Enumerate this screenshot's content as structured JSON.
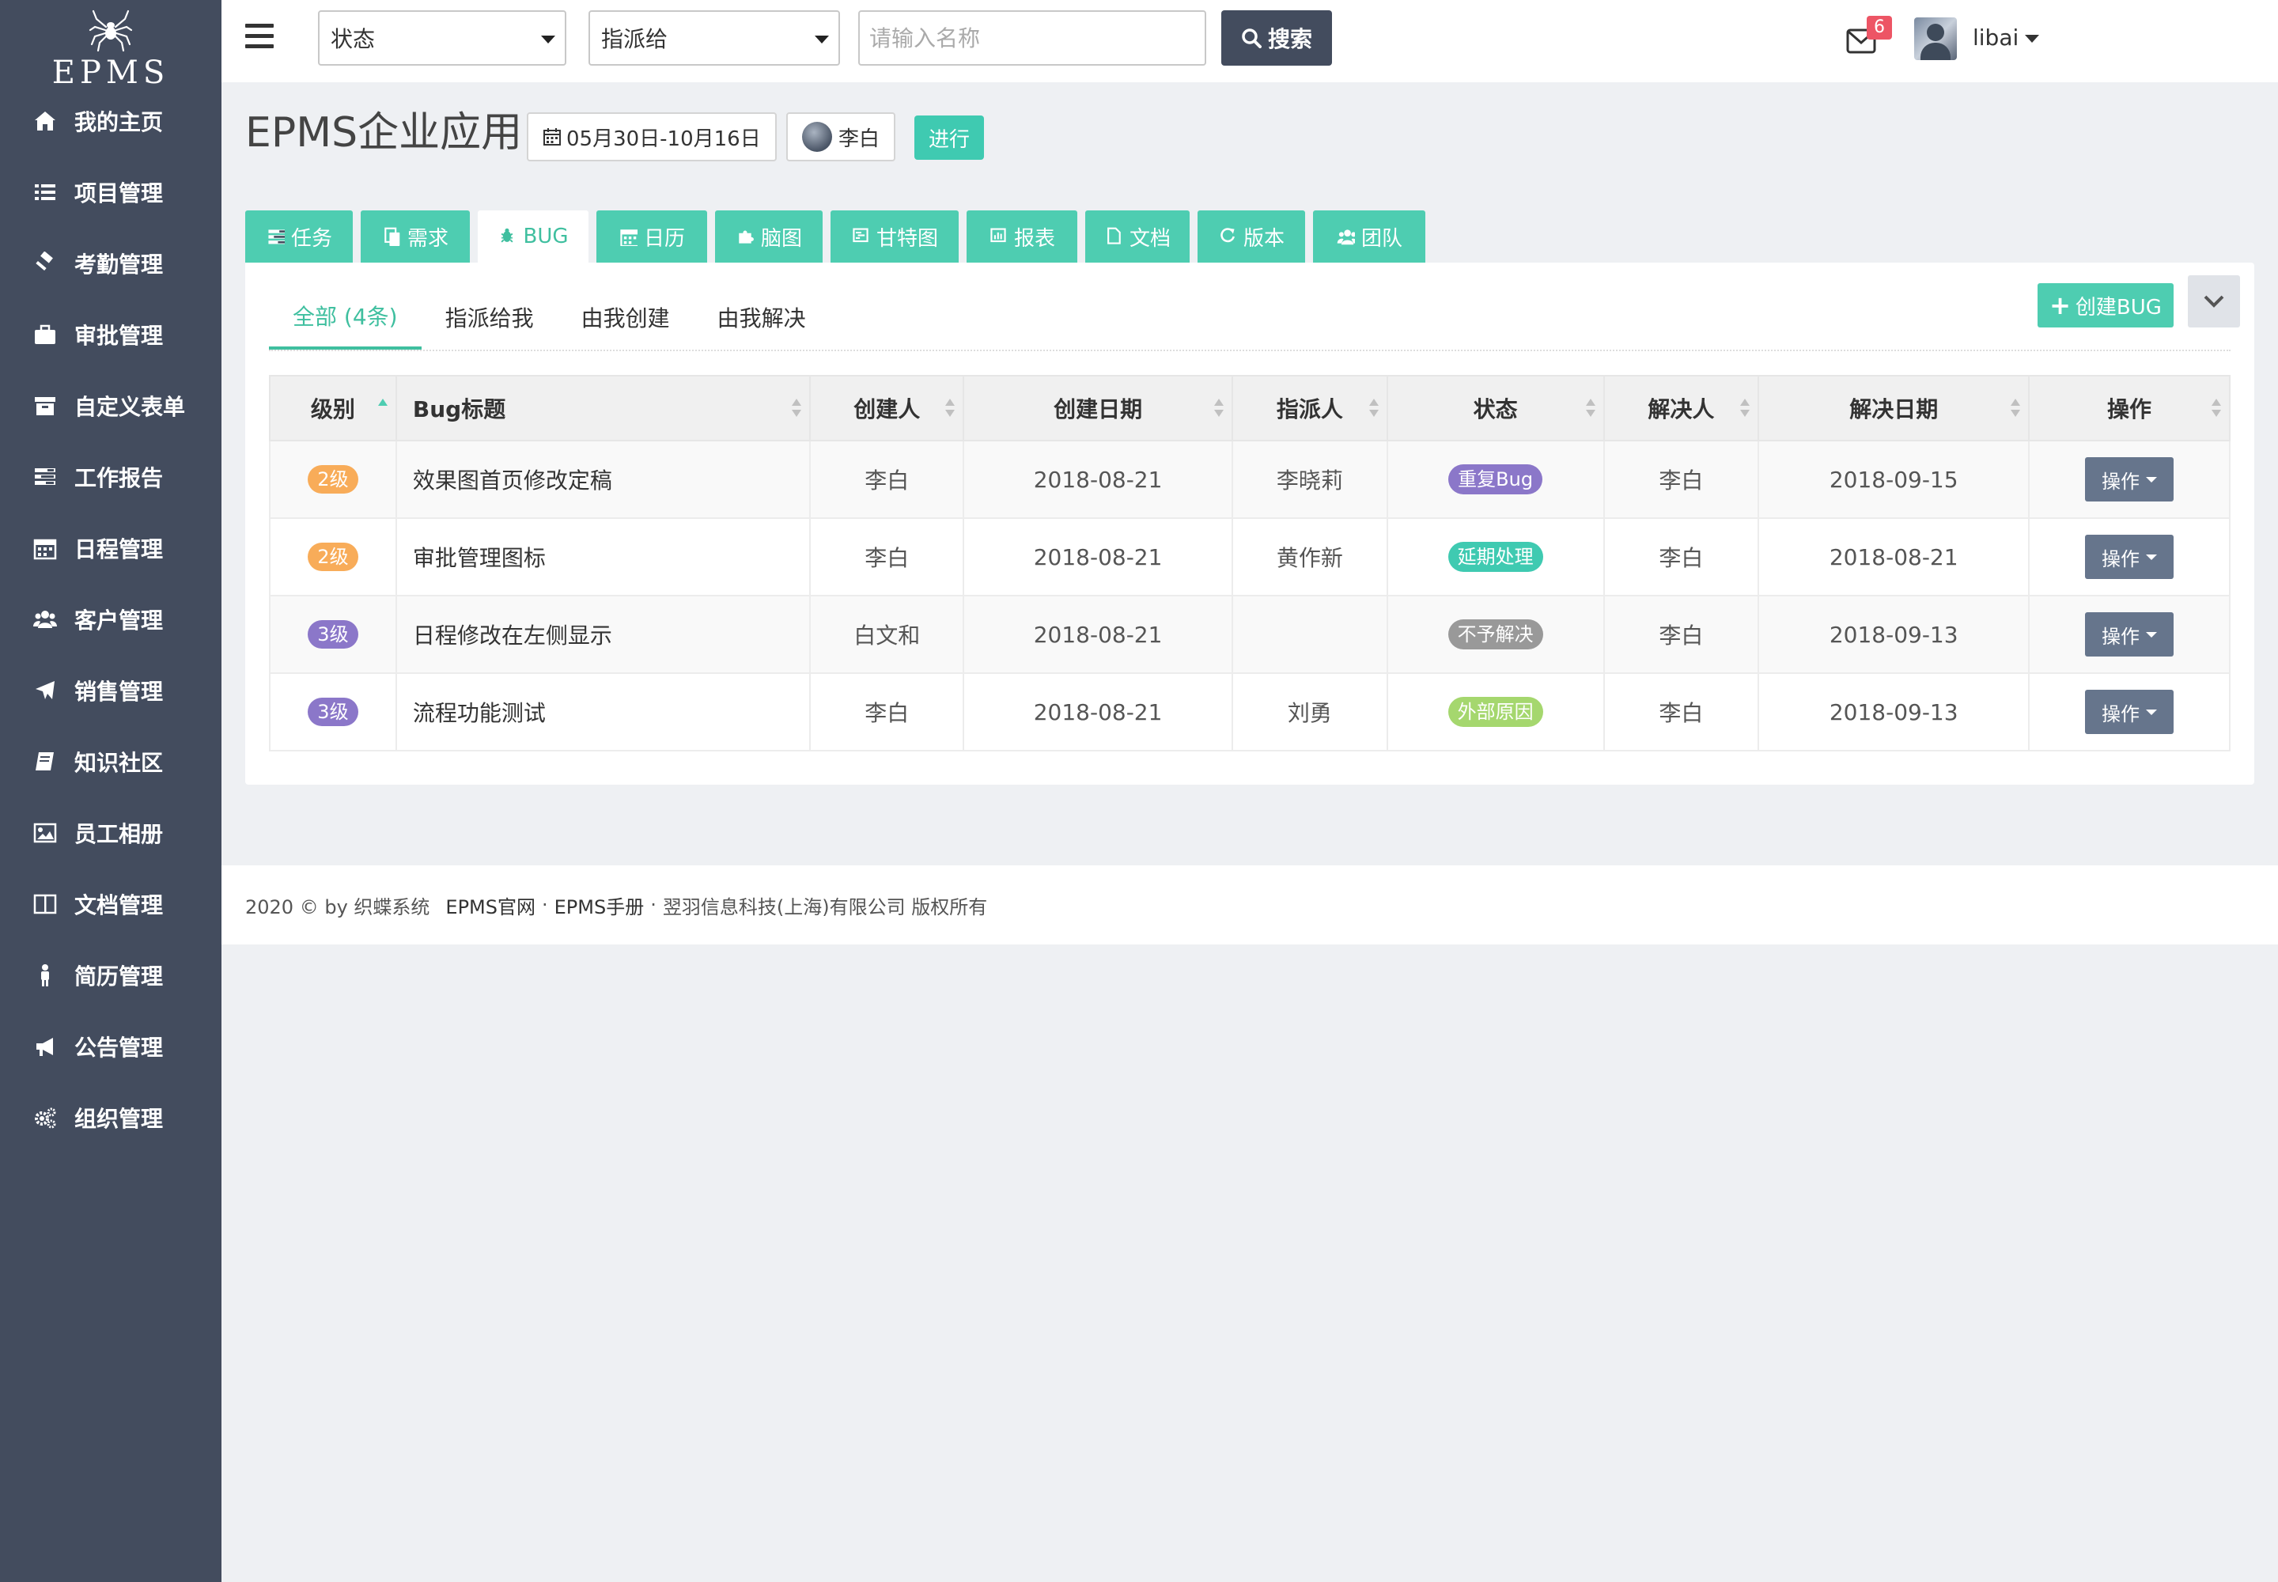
{
  "brand": {
    "name": "EPMS"
  },
  "sidebar": {
    "items": [
      {
        "label": "我的主页",
        "icon": "home-icon"
      },
      {
        "label": "项目管理",
        "icon": "list-icon"
      },
      {
        "label": "考勤管理",
        "icon": "gavel-icon"
      },
      {
        "label": "审批管理",
        "icon": "briefcase-icon"
      },
      {
        "label": "自定义表单",
        "icon": "archive-icon"
      },
      {
        "label": "工作报告",
        "icon": "tasks-icon"
      },
      {
        "label": "日程管理",
        "icon": "calendar-icon"
      },
      {
        "label": "客户管理",
        "icon": "users-icon"
      },
      {
        "label": "销售管理",
        "icon": "plane-icon"
      },
      {
        "label": "知识社区",
        "icon": "book-icon"
      },
      {
        "label": "员工相册",
        "icon": "image-icon"
      },
      {
        "label": "文档管理",
        "icon": "columns-icon"
      },
      {
        "label": "简历管理",
        "icon": "male-icon"
      },
      {
        "label": "公告管理",
        "icon": "bullhorn-icon"
      },
      {
        "label": "组织管理",
        "icon": "cogs-icon"
      }
    ]
  },
  "topbar": {
    "status_select": "状态",
    "assignee_select": "指派给",
    "search_placeholder": "请输入名称",
    "search_label": "搜索",
    "mail_count": "6",
    "username": "libai"
  },
  "project": {
    "title": "EPMS企业应用",
    "date_range": "05月30日-10月16日",
    "owner": "李白",
    "status": "进行"
  },
  "tabs": [
    {
      "label": "任务",
      "icon": "tasks-icon",
      "active": false
    },
    {
      "label": "需求",
      "icon": "copy-icon",
      "active": false
    },
    {
      "label": "BUG",
      "icon": "bug-icon",
      "active": true
    },
    {
      "label": "日历",
      "icon": "calendar-icon",
      "active": false
    },
    {
      "label": "脑图",
      "icon": "puzzle-icon",
      "active": false
    },
    {
      "label": "甘特图",
      "icon": "gantt-icon",
      "active": false
    },
    {
      "label": "报表",
      "icon": "bar-chart-icon",
      "active": false
    },
    {
      "label": "文档",
      "icon": "file-icon",
      "active": false
    },
    {
      "label": "版本",
      "icon": "refresh-icon",
      "active": false
    },
    {
      "label": "团队",
      "icon": "users-icon",
      "active": false
    }
  ],
  "subtabs": [
    {
      "label": "全部 (4条)",
      "active": true
    },
    {
      "label": "指派给我",
      "active": false
    },
    {
      "label": "由我创建",
      "active": false
    },
    {
      "label": "由我解决",
      "active": false
    }
  ],
  "create_label": "创建BUG",
  "table": {
    "headers": [
      "级别",
      "Bug标题",
      "创建人",
      "创建日期",
      "指派人",
      "状态",
      "解决人",
      "解决日期",
      "操作"
    ],
    "rows": [
      {
        "level": "2级",
        "level_color": "#f8ac59",
        "title": "效果图首页修改定稿",
        "creator": "李白",
        "created": "2018-08-21",
        "assignee": "李晓莉",
        "status": "重复Bug",
        "status_color": "#8b77c9",
        "resolver": "李白",
        "resolved": "2018-09-15",
        "op": "操作"
      },
      {
        "level": "2级",
        "level_color": "#f8ac59",
        "title": "审批管理图标",
        "creator": "李白",
        "created": "2018-08-21",
        "assignee": "黄作新",
        "status": "延期处理",
        "status_color": "#3fcab1",
        "resolver": "李白",
        "resolved": "2018-08-21",
        "op": "操作"
      },
      {
        "level": "3级",
        "level_color": "#8b77c9",
        "title": "日程修改在左侧显示",
        "creator": "白文和",
        "created": "2018-08-21",
        "assignee": "",
        "status": "不予解决",
        "status_color": "#999999",
        "resolver": "李白",
        "resolved": "2018-09-13",
        "op": "操作"
      },
      {
        "level": "3级",
        "level_color": "#8b77c9",
        "title": "流程功能测试",
        "creator": "李白",
        "created": "2018-08-21",
        "assignee": "刘勇",
        "status": "外部原因",
        "status_color": "#a5d76e",
        "resolver": "李白",
        "resolved": "2018-09-13",
        "op": "操作"
      }
    ]
  },
  "footer": {
    "copyright": "2020 © by 织蝶系统",
    "link1": "EPMS官网",
    "link2": "EPMS手册",
    "company": "翌羽信息科技(上海)有限公司 版权所有",
    "sep": "·"
  }
}
